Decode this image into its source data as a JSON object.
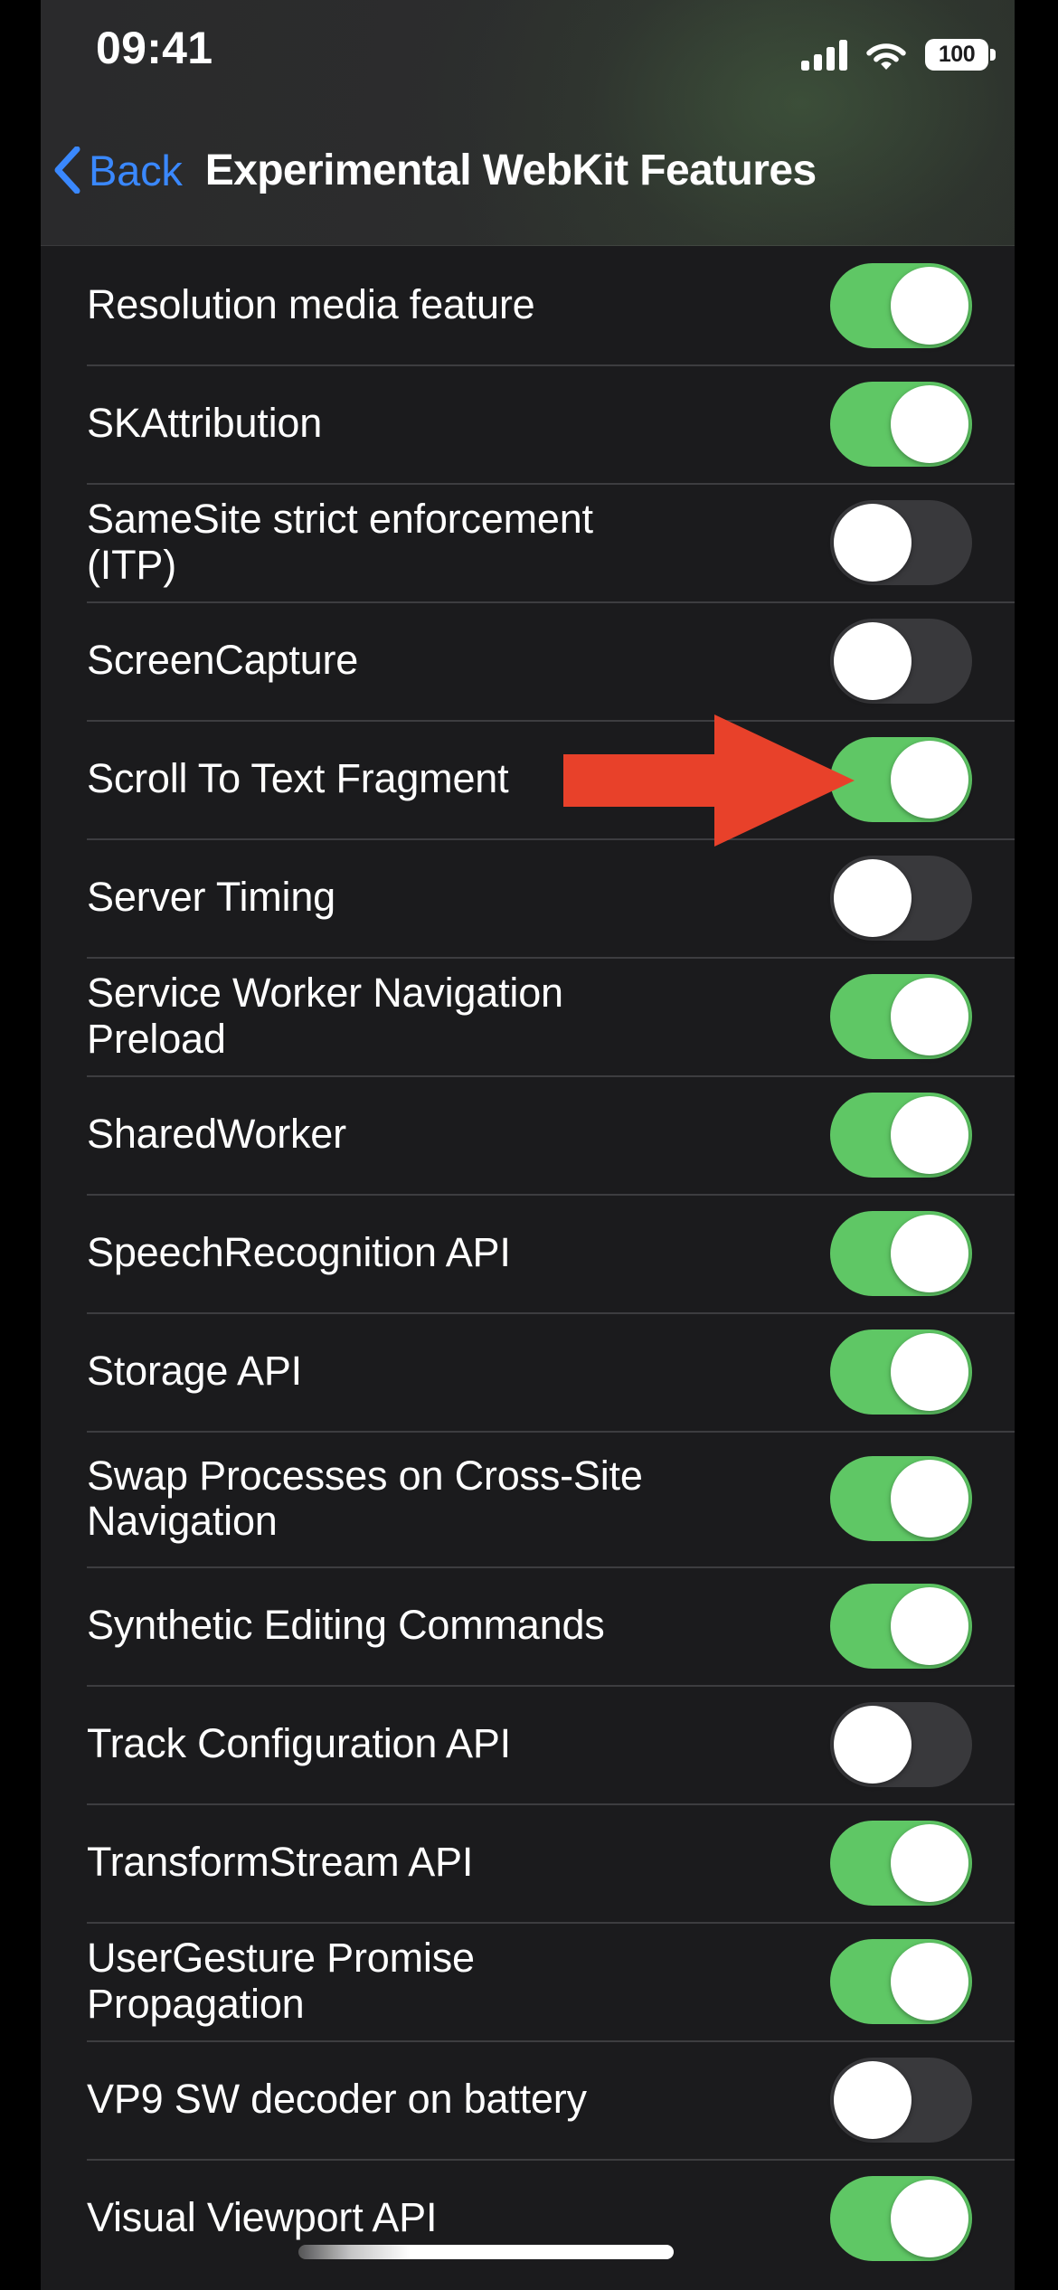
{
  "status_bar": {
    "time": "09:41",
    "signal_icon": "cellular-signal-icon",
    "signal_bars_filled": 4,
    "wifi_icon": "wifi-icon",
    "battery_icon": "battery-icon",
    "battery_level": "100"
  },
  "nav": {
    "back_label": "Back",
    "back_icon": "chevron-left-icon",
    "title": "Experimental WebKit Features"
  },
  "colors": {
    "accent_blue": "#3a88fe",
    "toggle_on": "#5fc765",
    "toggle_off": "#39393c",
    "background": "#1b1b1d",
    "annotation_red": "#e8412a",
    "separator": "#3d3d40"
  },
  "annotation": {
    "type": "arrow",
    "direction": "right",
    "color": "#e8412a",
    "points_at": "Scroll To Text Fragment"
  },
  "home_indicator": "home-indicator",
  "list": {
    "rows": [
      {
        "label": "Resolution media feature",
        "state": "on",
        "two_line": false
      },
      {
        "label": "SKAttribution",
        "state": "on",
        "two_line": false
      },
      {
        "label": "SameSite strict enforcement (ITP)",
        "state": "off",
        "two_line": false
      },
      {
        "label": "ScreenCapture",
        "state": "off",
        "two_line": false
      },
      {
        "label": "Scroll To Text Fragment",
        "state": "on",
        "two_line": false
      },
      {
        "label": "Server Timing",
        "state": "off",
        "two_line": false
      },
      {
        "label": "Service Worker Navigation Preload",
        "state": "on",
        "two_line": false
      },
      {
        "label": "SharedWorker",
        "state": "on",
        "two_line": false
      },
      {
        "label": "SpeechRecognition API",
        "state": "on",
        "two_line": false
      },
      {
        "label": "Storage API",
        "state": "on",
        "two_line": false
      },
      {
        "label": "Swap Processes on Cross-Site Navigation",
        "state": "on",
        "two_line": true
      },
      {
        "label": "Synthetic Editing Commands",
        "state": "on",
        "two_line": false
      },
      {
        "label": "Track Configuration API",
        "state": "off",
        "two_line": false
      },
      {
        "label": "TransformStream API",
        "state": "on",
        "two_line": false
      },
      {
        "label": "UserGesture Promise Propagation",
        "state": "on",
        "two_line": false
      },
      {
        "label": "VP9 SW decoder on battery",
        "state": "off",
        "two_line": false
      },
      {
        "label": "Visual Viewport API",
        "state": "on",
        "two_line": false
      }
    ]
  }
}
